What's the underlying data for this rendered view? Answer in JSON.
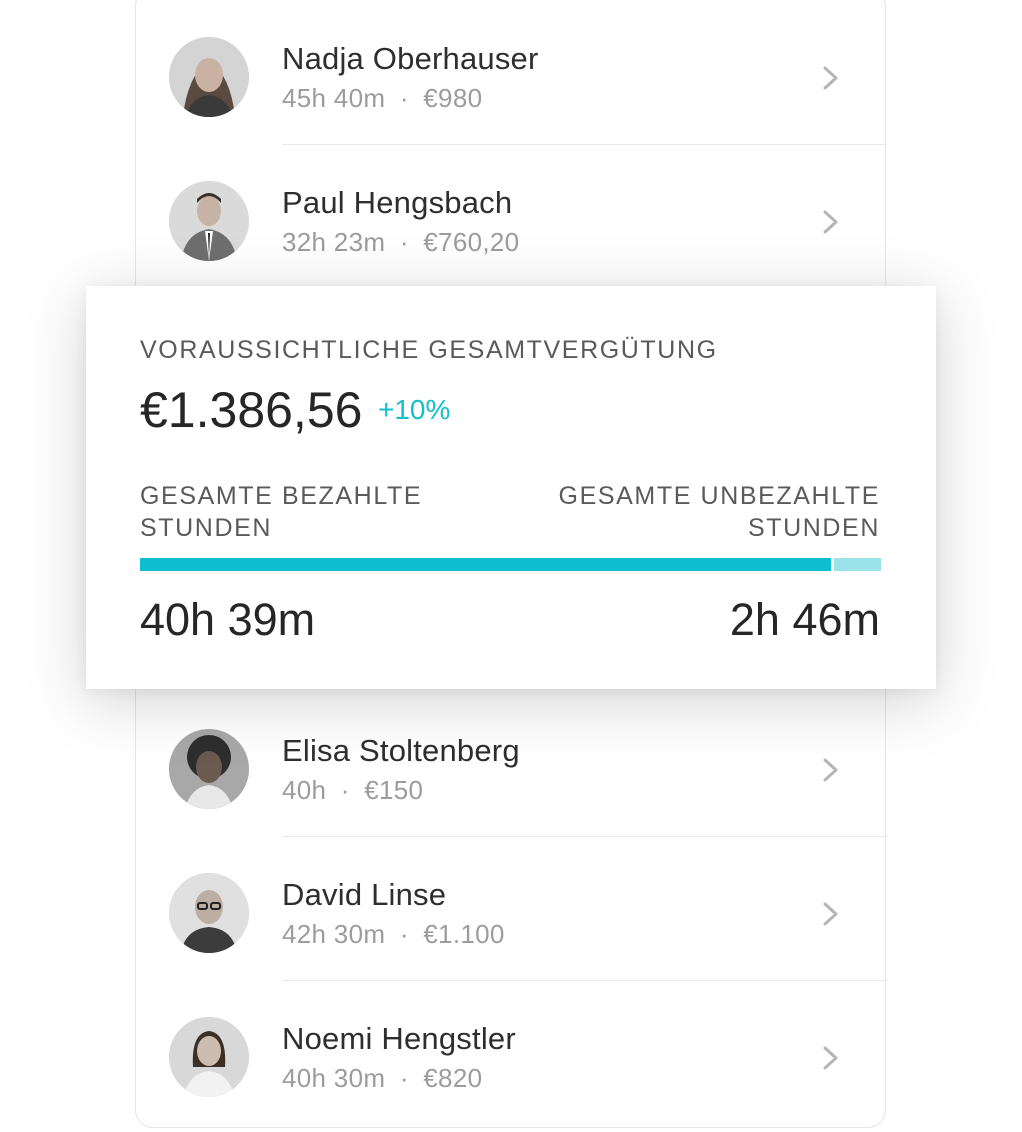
{
  "employees": [
    {
      "name": "Nadja Oberhauser",
      "hours": "45h 40m",
      "pay": "€980",
      "avatar_icon": "woman-portrait-icon"
    },
    {
      "name": "Paul Hengsbach",
      "hours": "32h 23m",
      "pay": "€760,20",
      "avatar_icon": "man-portrait-icon"
    },
    {
      "name": "Elisa Stoltenberg",
      "hours": "40h",
      "pay": "€150",
      "avatar_icon": "woman-portrait-icon"
    },
    {
      "name": "David Linse",
      "hours": "42h 30m",
      "pay": "€1.100",
      "avatar_icon": "man-portrait-icon"
    },
    {
      "name": "Noemi Hengstler",
      "hours": "40h 30m",
      "pay": "€820",
      "avatar_icon": "woman-portrait-icon"
    }
  ],
  "separator": "·",
  "summary": {
    "title": "VORAUSSICHTLICHE GESAMTVERGÜTUNG",
    "amount": "€1.386,56",
    "change": "+10%",
    "paid_label_line1": "GESAMTE BEZAHLTE",
    "paid_label_line2": "STUNDEN",
    "unpaid_label_line1": "GESAMTE UNBEZAHLTE",
    "unpaid_label_line2": "STUNDEN",
    "paid_value": "40h 39m",
    "unpaid_value": "2h 46m",
    "paid_fraction": 0.936
  },
  "colors": {
    "accent": "#12bfcb",
    "accent_light": "#9be3ea",
    "text_primary": "#2e2e2e",
    "text_secondary": "#9c9c9c"
  }
}
